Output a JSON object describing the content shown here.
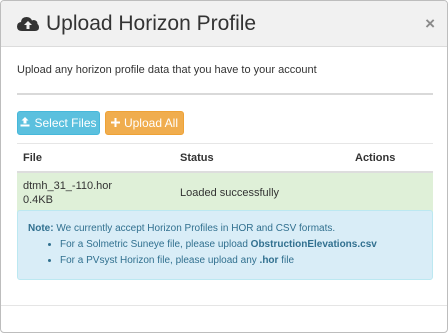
{
  "dialog": {
    "title": "Upload Horizon Profile",
    "close_glyph": "×",
    "header_icon": "cloud-upload-icon"
  },
  "intro_text": "Upload any horizon profile data that you have to your account",
  "buttons": {
    "select_files": "Select Files",
    "upload_all": "Upload All",
    "select_icon": "upload-icon",
    "upload_icon": "plus-icon"
  },
  "table": {
    "headers": {
      "file": "File",
      "status": "Status",
      "actions": "Actions"
    },
    "rows": [
      {
        "file_name": "dtmh_31_-110.hor",
        "file_size": "0.4KB",
        "status": "Loaded successfully",
        "actions": ""
      }
    ]
  },
  "note": {
    "label": "Note:",
    "text": "We currently accept Horizon Profiles in HOR and CSV formats.",
    "items": [
      {
        "prefix": "For a Solmetric Suneye file, please upload ",
        "bold": "ObstructionElevations.csv",
        "suffix": ""
      },
      {
        "prefix": "For a PVsyst Horizon file, please upload any ",
        "bold": ".hor",
        "suffix": " file"
      }
    ]
  },
  "colors": {
    "info_button": "#5bc0de",
    "warning_button": "#f0ad4e",
    "success_row": "#dff0d8",
    "info_panel": "#d9edf7",
    "info_text": "#31708f"
  }
}
